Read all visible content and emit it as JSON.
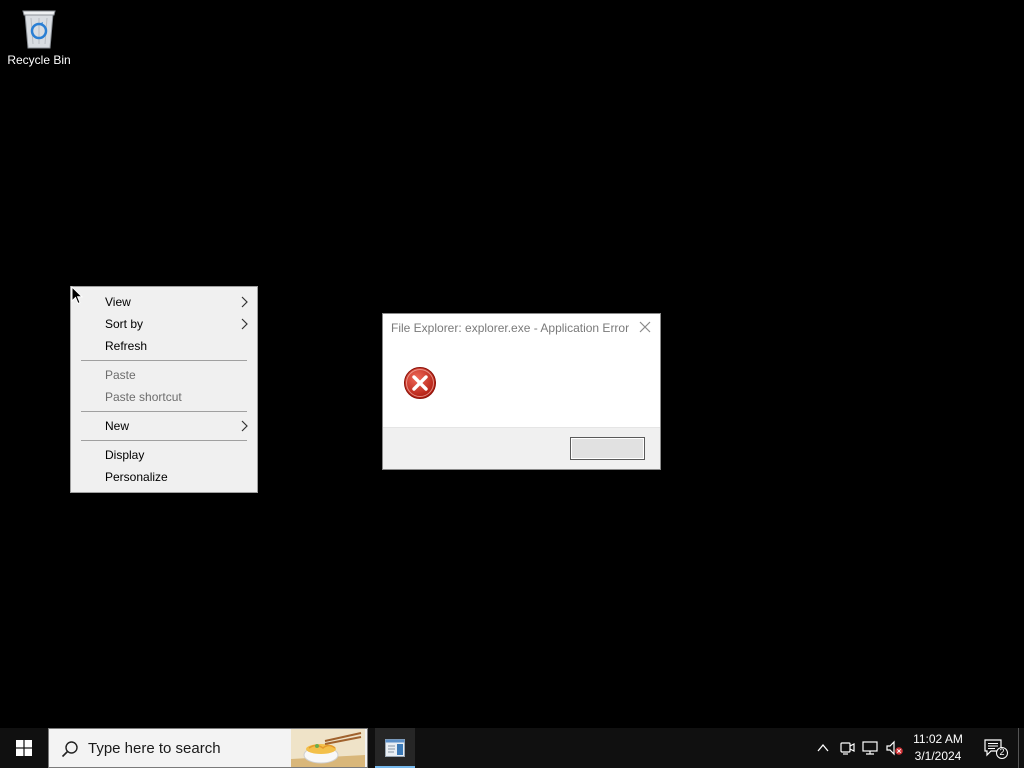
{
  "desktop": {
    "icons": [
      {
        "label": "Recycle Bin",
        "icon": "recycle-bin-icon"
      }
    ]
  },
  "context_menu": {
    "items": [
      {
        "label": "View",
        "submenu": true,
        "enabled": true
      },
      {
        "label": "Sort by",
        "submenu": true,
        "enabled": true
      },
      {
        "label": "Refresh",
        "submenu": false,
        "enabled": true
      },
      {
        "label": "Paste",
        "submenu": false,
        "enabled": false
      },
      {
        "label": "Paste shortcut",
        "submenu": false,
        "enabled": false
      },
      {
        "label": "New",
        "submenu": true,
        "enabled": true
      },
      {
        "label": "Display",
        "submenu": false,
        "enabled": true
      },
      {
        "label": "Personalize",
        "submenu": false,
        "enabled": true
      }
    ]
  },
  "dialog": {
    "title": "File Explorer: explorer.exe - Application Error",
    "icon": "error-icon",
    "ok_label": ""
  },
  "taskbar": {
    "search_placeholder": "Type here to search",
    "clock_time": "11:02 AM",
    "clock_date": "3/1/2024",
    "notification_count": "2"
  },
  "colors": {
    "desktop_bg": "#000000",
    "taskbar_bg": "#101010",
    "error_red": "#c42b1c",
    "active_underline": "#76b9ed"
  }
}
